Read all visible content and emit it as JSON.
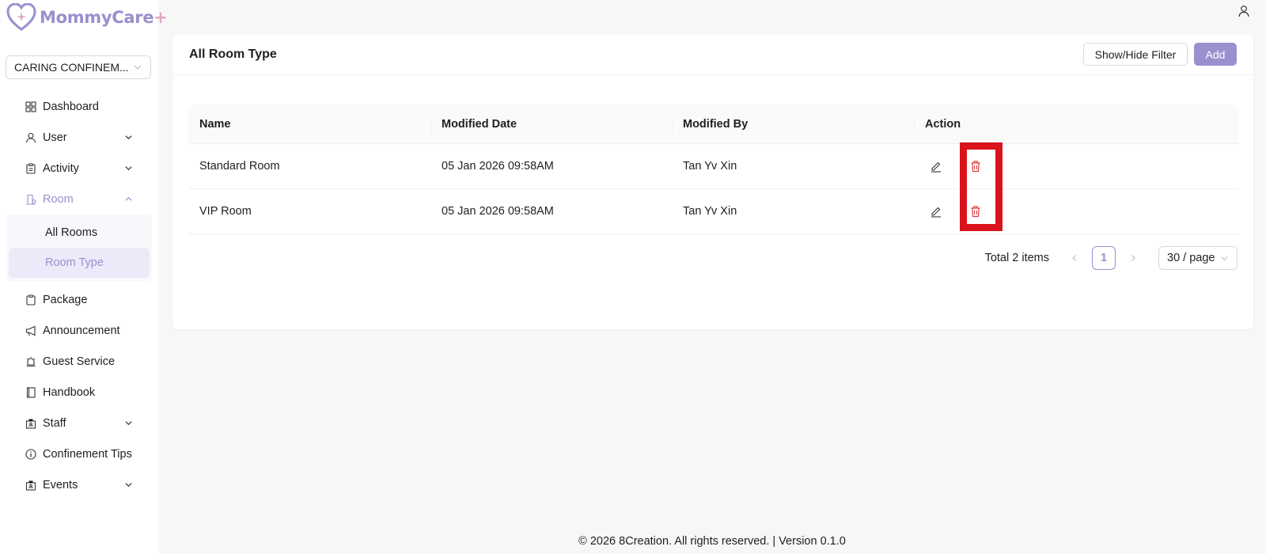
{
  "app": {
    "name": "MommyCare",
    "name_suffix": "+"
  },
  "org_select": {
    "value": "CARING CONFINEM..."
  },
  "sidebar": {
    "items": [
      {
        "label": "Dashboard",
        "icon": "dashboard-icon"
      },
      {
        "label": "User",
        "icon": "user-icon",
        "expandable": true
      },
      {
        "label": "Activity",
        "icon": "activity-icon",
        "expandable": true
      },
      {
        "label": "Room",
        "icon": "room-icon",
        "expandable": true,
        "open": true
      },
      {
        "label": "Package",
        "icon": "package-icon"
      },
      {
        "label": "Announcement",
        "icon": "megaphone-icon"
      },
      {
        "label": "Guest Service",
        "icon": "bell-icon"
      },
      {
        "label": "Handbook",
        "icon": "book-icon"
      },
      {
        "label": "Staff",
        "icon": "staff-icon",
        "expandable": true
      },
      {
        "label": "Confinement Tips",
        "icon": "info-icon"
      },
      {
        "label": "Events",
        "icon": "events-icon",
        "expandable": true
      }
    ],
    "room_sub": [
      {
        "label": "All Rooms"
      },
      {
        "label": "Room Type",
        "active": true
      }
    ]
  },
  "card": {
    "title": "All Room Type",
    "filter_button": "Show/Hide Filter",
    "add_button": "Add"
  },
  "table": {
    "columns": [
      "Name",
      "Modified Date",
      "Modified By",
      "Action"
    ],
    "rows": [
      {
        "name": "Standard Room",
        "modified_date": "05 Jan 2026 09:58AM",
        "modified_by": "Tan Yv Xin"
      },
      {
        "name": "VIP Room",
        "modified_date": "05 Jan 2026 09:58AM",
        "modified_by": "Tan Yv Xin"
      }
    ]
  },
  "pagination": {
    "total": "Total 2 items",
    "current_page": "1",
    "page_size": "30 / page"
  },
  "footer": "© 2026 8Creation. All rights reserved. | Version 0.1.0",
  "colors": {
    "accent": "#9b8fcf",
    "danger": "#d9141c",
    "logo_plus": "#e2a6c4"
  }
}
